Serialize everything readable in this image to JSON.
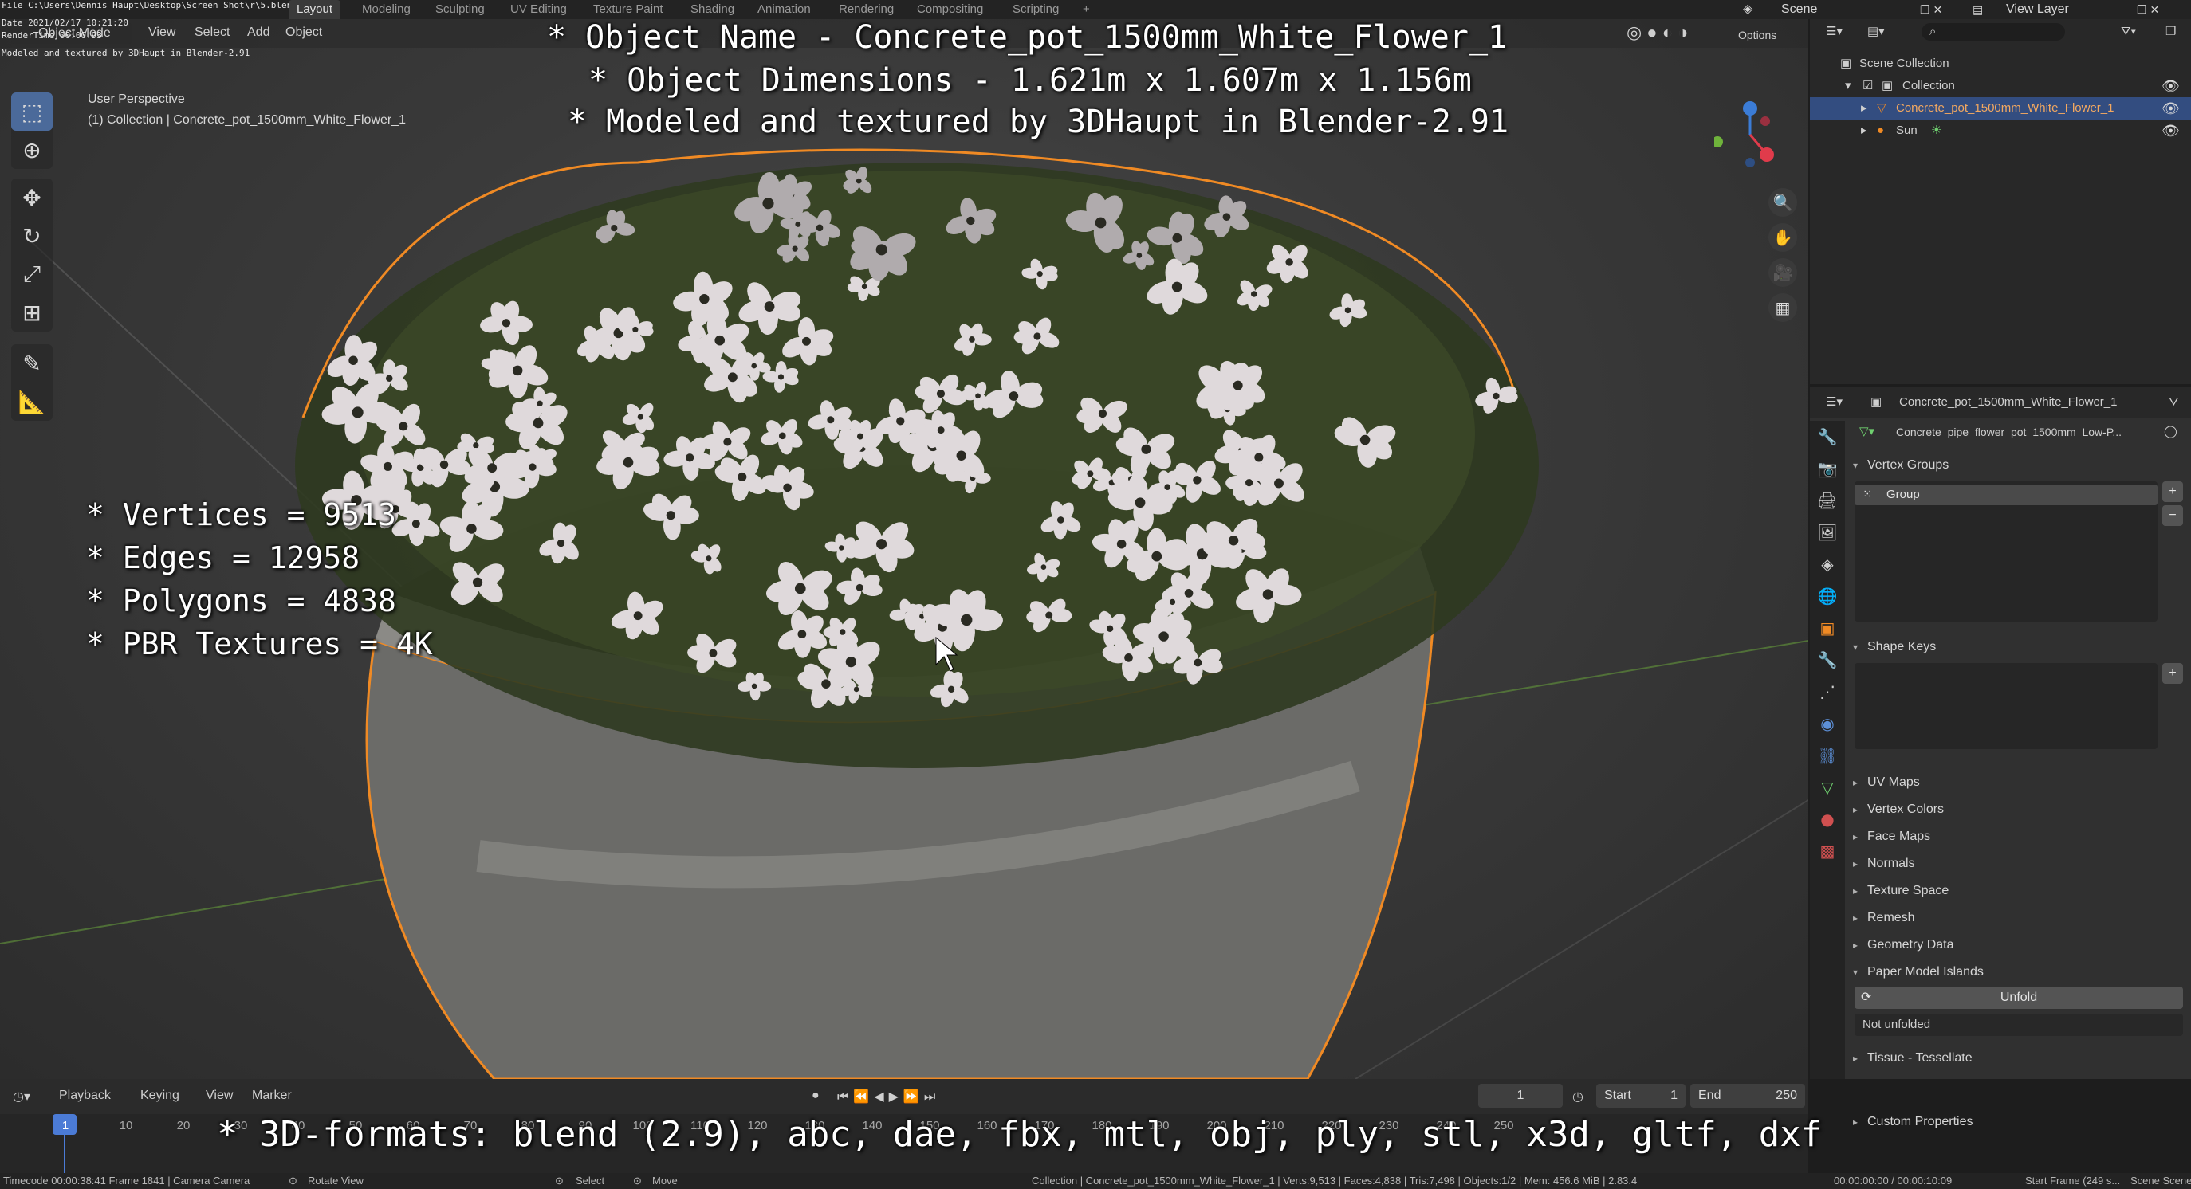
{
  "render_info": {
    "file_line": "File C:\\Users\\Dennis Haupt\\Desktop\\Screen Shot\\r\\5.blend",
    "date_line": "Date 2021/02/17 10:21:20",
    "rendertime_line": "RenderTime 00:00.93",
    "credit_line": "Modeled and textured by 3DHaupt in Blender-2.91"
  },
  "topbar": {
    "workspaces": [
      "Layout",
      "Modeling",
      "Sculpting",
      "UV Editing",
      "Texture Paint",
      "Shading",
      "Animation",
      "Rendering",
      "Compositing",
      "Scripting",
      "+"
    ],
    "active_workspace": "Layout",
    "scene_label": "Scene",
    "view_layer_label": "View Layer"
  },
  "viewport_header": {
    "mode": "Object Mode",
    "menus": [
      "View",
      "Select",
      "Add",
      "Object"
    ],
    "options_label": "Options"
  },
  "viewport": {
    "perspective": "User Perspective",
    "collection_info": "(1) Collection | Concrete_pot_1500mm_White_Flower_1"
  },
  "overlay": {
    "title_lines": [
      "* Object Name - Concrete_pot_1500mm_White_Flower_1",
      "* Object Dimensions -  1.621m x 1.607m x 1.156m",
      "* Modeled and textured by 3DHaupt in Blender-2.91"
    ],
    "stats_lines": [
      "* Vertices = 9513",
      "* Edges = 12958",
      "* Polygons = 4838",
      "* PBR Textures = 4K"
    ],
    "formats_line": "* 3D-formats: blend (2.9), abc, dae, fbx, mtl, obj, ply, stl, x3d, gltf, dxf"
  },
  "outliner": {
    "scene_collection": "Scene Collection",
    "collection": "Collection",
    "objects": [
      "Concrete_pot_1500mm_White_Flower_1",
      "Sun"
    ]
  },
  "properties": {
    "object_name": "Concrete_pot_1500mm_White_Flower_1",
    "mesh_name": "Concrete_pipe_flower_pot_1500mm_Low-P...",
    "vertex_groups_title": "Vertex Groups",
    "vertex_group_item": "Group",
    "shape_keys_title": "Shape Keys",
    "collapsed_panels": [
      "UV Maps",
      "Vertex Colors",
      "Face Maps",
      "Normals",
      "Texture Space",
      "Remesh",
      "Geometry Data"
    ],
    "paper_model_title": "Paper Model Islands",
    "unfold_button": "Unfold",
    "not_unfolded": "Not unfolded",
    "tissue_title": "Tissue - Tessellate",
    "custom_props_title": "Custom Properties"
  },
  "timeline": {
    "menus": [
      "Playback",
      "Keying",
      "View",
      "Marker"
    ],
    "current_frame": "1",
    "start_label": "Start",
    "start_value": "1",
    "end_label": "End",
    "end_value": "250",
    "ruler_ticks": [
      "1",
      "10",
      "20",
      "30",
      "40",
      "50",
      "60",
      "70",
      "80",
      "90",
      "100",
      "110",
      "120",
      "130",
      "140",
      "150",
      "160",
      "170",
      "180",
      "190",
      "200",
      "210",
      "220",
      "230",
      "240",
      "250"
    ]
  },
  "statusbar": {
    "left_hint": "Timecode 00:00:38:41   Frame 1841 | Camera Camera",
    "rotate_hint": "Rotate View",
    "select_hint": "Select",
    "move_hint": "Move",
    "stats": "Collection | Concrete_pot_1500mm_White_Flower_1 | Verts:9,513 | Faces:4,838 | Tris:7,498 | Objects:1/2 | Mem: 456.6 MiB | 2.83.4",
    "time": "00:00:00:00 / 00:00:10:09",
    "start_frame": "Start Frame (249 s...",
    "scene": "Scene Scene"
  },
  "colors": {
    "selection_outline": "#f08a24",
    "accent_blue": "#334d80",
    "active_tool": "#4b6a9a"
  }
}
